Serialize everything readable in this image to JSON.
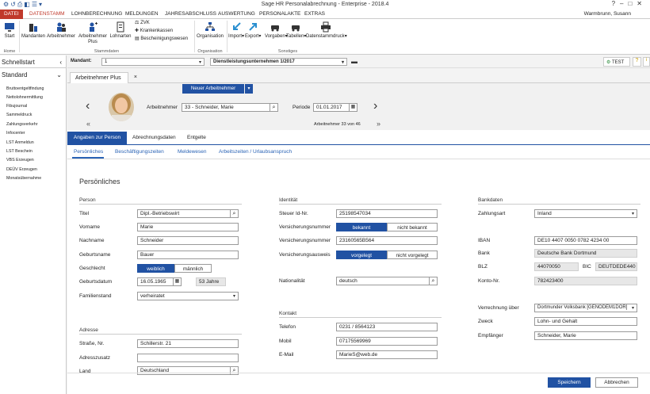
{
  "window": {
    "title": "Sage HR Personalabrechnung - Enterprise - 2018.4",
    "user": "Warmbrunn, Susann",
    "help": "?"
  },
  "menu": {
    "datei": "DATEI",
    "items": [
      "DATENSTAMM",
      "LOHNBERECHNUNG",
      "MELDUNGEN",
      "JAHRESABSCHLUSS",
      "AUSWERTUNG",
      "PERSONALAKTE",
      "EXTRAS"
    ]
  },
  "ribbon": {
    "start": "Start",
    "home_group": "Home",
    "mandanten": "Mandanten",
    "arbeitnehmer": "Arbeitnehmer",
    "arbeitnehmer_plus_1": "Arbeitnehmer",
    "arbeitnehmer_plus_2": "Plus",
    "lohnarten": "Lohnarten",
    "zvk": "ZVK",
    "krankenkassen": "Krankenkassen",
    "bescheinigungswesen": "Bescheinigungswesen",
    "stammdaten_group": "Stammdaten",
    "organisation": "Organisation",
    "organisation_group": "Organisation",
    "import": "Import",
    "export": "Export",
    "vorgaben": "Vorgaben",
    "tabellen": "Tabellen",
    "datenstammdruck": "Datenstammdruck",
    "sonstiges_group": "Sonstiges"
  },
  "sidebar": {
    "schnellstart": "Schnellstart",
    "standard": "Standard",
    "items": [
      "Bruttoentgeltfindung",
      "Nettolohnermittlung",
      "Fibujournal",
      "Sammeldruck",
      "Zahlungsverkehr",
      "Infocenter",
      "LST Anmeldun",
      "LST Beschein",
      "VBS Erzeugen",
      "DEÜV Erzeugen",
      "Monatsübernahme"
    ]
  },
  "topbar": {
    "mandant_label": "Mandant:",
    "mandant_nr": "1",
    "mandant_name": "Dienstleistungsunternehmen 1/2017",
    "test": "TEST"
  },
  "doc_tab": {
    "label": "Arbeitnehmer Plus",
    "close": "×"
  },
  "header": {
    "new_button": "Neuer Arbeitnehmer",
    "arbeitnehmer_label": "Arbeitnehmer",
    "arbeitnehmer_value": "33 - Schneider, Marie",
    "periode_label": "Periode",
    "periode_value": "01.01.2017",
    "counter": "Arbeitnehmer 33 von 46"
  },
  "tabs": [
    "Angaben zur Person",
    "Abrechnungsdaten",
    "Entgelte"
  ],
  "subtabs": [
    "Persönliches",
    "Beschäftigungszeiten",
    "Meldewesen",
    "Arbeitszeiten / Urlaubsanspruch"
  ],
  "form": {
    "heading": "Persönliches",
    "person": {
      "section": "Person",
      "titel_label": "Titel",
      "titel": "Dipl.-Betriebswirt",
      "vorname_label": "Vorname",
      "vorname": "Marie",
      "nachname_label": "Nachname",
      "nachname": "Schneider",
      "geburtsname_label": "Geburtsname",
      "geburtsname": "Bauer",
      "geschlecht_label": "Geschlecht",
      "weiblich": "weiblich",
      "maennlich": "männlich",
      "geburtsdatum_label": "Geburtsdatum",
      "geburtsdatum": "16.05.1965",
      "alter": "53 Jahre",
      "familienstand_label": "Familienstand",
      "familienstand": "verheiratet"
    },
    "adresse": {
      "section": "Adresse",
      "strasse_label": "Straße, Nr.",
      "strasse": "Schillerstr. 21",
      "zusatz_label": "Adresszusatz",
      "zusatz": "",
      "land_label": "Land",
      "land": "Deutschland"
    },
    "identitaet": {
      "section": "Identität",
      "steuer_label": "Steuer Id-Nr.",
      "steuer": "25198547034",
      "vsnr1_label": "Versicherungsnummer",
      "bekannt": "bekannt",
      "nicht_bekannt": "nicht bekannt",
      "vsnr2_label": "Versicherungsnummer",
      "vsnr": "23160565B564",
      "ausweis_label": "Versicherungsausweis",
      "vorgelegt": "vorgelegt",
      "nicht_vorgelegt": "nicht vorgelegt",
      "nationalitaet_label": "Nationalität",
      "nationalitaet": "deutsch"
    },
    "kontakt": {
      "section": "Kontakt",
      "telefon_label": "Telefon",
      "telefon": "0231 / 8564123",
      "mobil_label": "Mobil",
      "mobil": "07175569969",
      "email_label": "E-Mail",
      "email": "MarieS@web.de"
    },
    "bank": {
      "section": "Bankdaten",
      "zahlungsart_label": "Zahlungsart",
      "zahlungsart": "Inland",
      "iban_label": "IBAN",
      "iban": "DE10 4407 0050 0782 4234 00",
      "bank_label": "Bank",
      "bank": "Deutsche Bank Dortmund",
      "blz_label": "BLZ",
      "blz": "44070050",
      "bic_label": "BIC",
      "bic": "DEUTDEDE440",
      "konto_label": "Konto-Nr.",
      "konto": "782423400",
      "verrechnung_label": "Verrechnung über",
      "verrechnung": "Dortmunder Volksbank [GENODEM1DOR]",
      "zweck_label": "Zweck",
      "zweck": "Lohn- und Gehalt",
      "empfaenger_label": "Empfänger",
      "empfaenger": "Schneider, Marie"
    }
  },
  "footer": {
    "save": "Speichern",
    "cancel": "Abbrechen"
  },
  "colors": {
    "accent_red": "#c0392b",
    "primary_blue": "#2152a3",
    "link_blue": "#2a63b5"
  }
}
